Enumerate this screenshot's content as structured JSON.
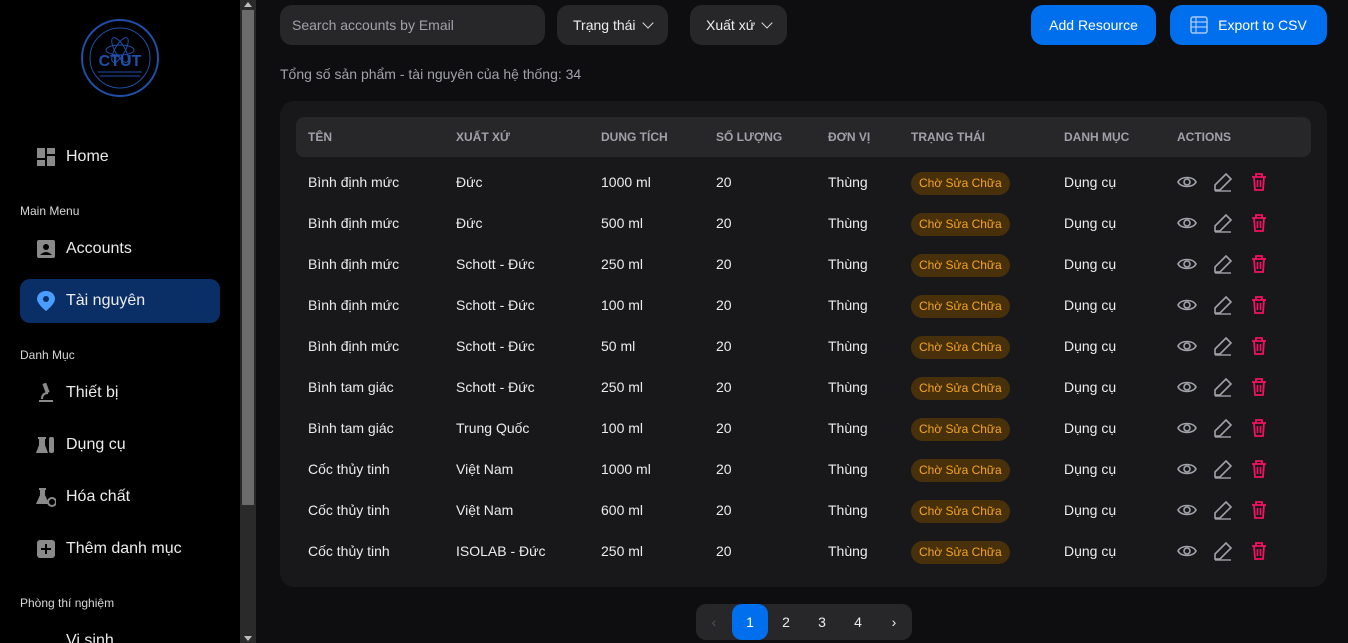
{
  "sidebar": {
    "logo_text": "CTUT",
    "home": "Home",
    "main_menu_label": "Main Menu",
    "accounts": "Accounts",
    "tai_nguyen": "Tài nguyên",
    "danh_muc_label": "Danh Mục",
    "thiet_bi": "Thiết bị",
    "dung_cu": "Dụng cụ",
    "hoa_chat": "Hóa chất",
    "them_danh_muc": "Thêm danh mục",
    "phong_label": "Phòng thí nghiệm",
    "vi_sinh": "Vi sinh"
  },
  "toolbar": {
    "search_placeholder": "Search accounts by Email",
    "status_filter": "Trạng thái",
    "origin_filter": "Xuất xứ",
    "add_label": "Add Resource",
    "export_label": "Export to CSV"
  },
  "total_text": "Tổng số sản phẩm - tài nguyên của hệ thống: 34",
  "table": {
    "headers": [
      "TÊN",
      "XUẤT XỨ",
      "DUNG TÍCH",
      "SỐ LƯỢNG",
      "ĐƠN VỊ",
      "TRẠNG THÁI",
      "DANH MỤC",
      "ACTIONS"
    ],
    "rows": [
      {
        "name": "Bình định mức",
        "origin": "Đức",
        "volume": "1000 ml",
        "qty": "20",
        "unit": "Thùng",
        "status": "Chờ Sửa Chữa",
        "category": "Dụng cụ"
      },
      {
        "name": "Bình định mức",
        "origin": "Đức",
        "volume": "500 ml",
        "qty": "20",
        "unit": "Thùng",
        "status": "Chờ Sửa Chữa",
        "category": "Dụng cụ"
      },
      {
        "name": "Bình định mức",
        "origin": "Schott - Đức",
        "volume": "250 ml",
        "qty": "20",
        "unit": "Thùng",
        "status": "Chờ Sửa Chữa",
        "category": "Dụng cụ"
      },
      {
        "name": "Bình định mức",
        "origin": "Schott - Đức",
        "volume": "100 ml",
        "qty": "20",
        "unit": "Thùng",
        "status": "Chờ Sửa Chữa",
        "category": "Dụng cụ"
      },
      {
        "name": "Bình định mức",
        "origin": "Schott - Đức",
        "volume": "50 ml",
        "qty": "20",
        "unit": "Thùng",
        "status": "Chờ Sửa Chữa",
        "category": "Dụng cụ"
      },
      {
        "name": "Bình tam giác",
        "origin": "Schott - Đức",
        "volume": "250 ml",
        "qty": "20",
        "unit": "Thùng",
        "status": "Chờ Sửa Chữa",
        "category": "Dụng cụ"
      },
      {
        "name": "Bình tam giác",
        "origin": "Trung Quốc",
        "volume": "100 ml",
        "qty": "20",
        "unit": "Thùng",
        "status": "Chờ Sửa Chữa",
        "category": "Dụng cụ"
      },
      {
        "name": "Cốc thủy tinh",
        "origin": "Việt Nam",
        "volume": "1000 ml",
        "qty": "20",
        "unit": "Thùng",
        "status": "Chờ Sửa Chữa",
        "category": "Dụng cụ"
      },
      {
        "name": "Cốc thủy tinh",
        "origin": "Việt Nam",
        "volume": "600 ml",
        "qty": "20",
        "unit": "Thùng",
        "status": "Chờ Sửa Chữa",
        "category": "Dụng cụ"
      },
      {
        "name": "Cốc thủy tinh",
        "origin": "ISOLAB - Đức",
        "volume": "250 ml",
        "qty": "20",
        "unit": "Thùng",
        "status": "Chờ Sửa Chữa",
        "category": "Dụng cụ"
      }
    ]
  },
  "pagination": {
    "prev": "‹",
    "pages": [
      "1",
      "2",
      "3",
      "4"
    ],
    "next": "›",
    "current": "1"
  },
  "colors": {
    "accent": "#006fee",
    "active_nav": "#0a2f66",
    "chip_bg": "#48300b",
    "chip_text": "#f5a524",
    "delete": "#f31260"
  }
}
